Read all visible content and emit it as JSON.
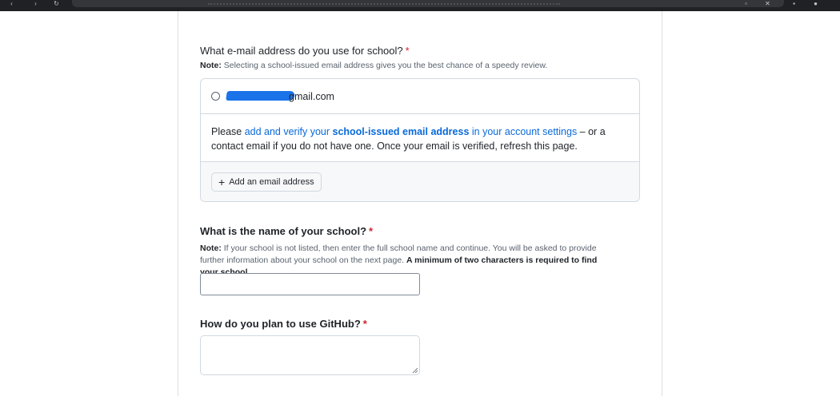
{
  "email_section": {
    "question": "What e-mail address do you use for school?",
    "required_mark": "*",
    "note_label": "Note:",
    "note_text": " Selecting a school-issued email address gives you the best chance of a speedy review.",
    "email_option": "gmail.com",
    "hint_prefix": "Please ",
    "hint_link_1": "add and verify your ",
    "hint_link_strong": "school-issued email address",
    "hint_link_2": " in your account settings",
    "hint_suffix": " – or a contact email if you do not have one. Once your email is verified, refresh this page.",
    "add_button": "Add an email address"
  },
  "school_section": {
    "question": "What is the name of your school?",
    "required_mark": "*",
    "note_label": "Note:",
    "note_text": " If your school is not listed, then enter the full school name and continue. You will be asked to provide further information about your school on the next page. ",
    "note_strong": "A minimum of two characters is required to find your school.",
    "input_value": ""
  },
  "usage_section": {
    "question": "How do you plan to use GitHub?",
    "required_mark": "*",
    "textarea_value": ""
  },
  "colors": {
    "link": "#0969da",
    "required": "#cf222e",
    "redaction": "#1a73e8"
  }
}
